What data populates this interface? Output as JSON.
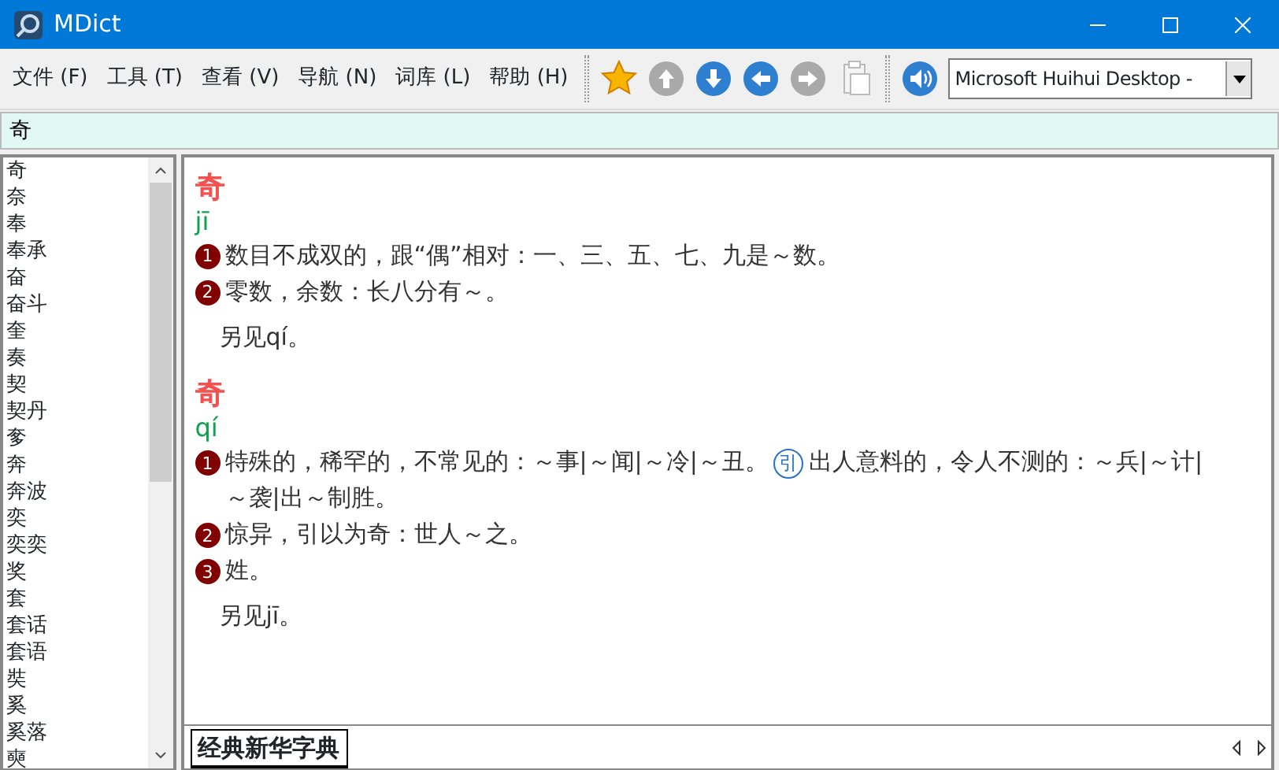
{
  "window": {
    "title": "MDict"
  },
  "menu": [
    "文件 (F)",
    "工具 (T)",
    "查看 (V)",
    "导航 (N)",
    "词库 (L)",
    "帮助 (H)"
  ],
  "toolbar": [
    {
      "kind": "star",
      "disabled": false
    },
    {
      "kind": "up",
      "disabled": true
    },
    {
      "kind": "down",
      "disabled": false
    },
    {
      "kind": "back",
      "disabled": false
    },
    {
      "kind": "forward",
      "disabled": true
    },
    {
      "kind": "clipboard",
      "disabled": true
    },
    {
      "kind": "speaker",
      "disabled": false
    }
  ],
  "voice": {
    "value": "Microsoft Huihui Desktop -"
  },
  "search": {
    "value": "奇"
  },
  "word_list": [
    "奇",
    "奈",
    "奉",
    "奉承",
    "奋",
    "奋斗",
    "奎",
    "奏",
    "契",
    "契丹",
    "奓",
    "奔",
    "奔波",
    "奕",
    "奕奕",
    "奖",
    "套",
    "套话",
    "套语",
    "奘",
    "奚",
    "奚落",
    "奭"
  ],
  "entries": [
    {
      "headword": "奇",
      "pinyin": "jī",
      "senses": [
        {
          "number": "1",
          "segments": [
            {
              "kind": "text",
              "text": "数目不成双的，跟“偶”相对：一、三、五、七、九是～数。"
            }
          ]
        },
        {
          "number": "2",
          "segments": [
            {
              "kind": "text",
              "text": "零数，余数：长八分有～。"
            }
          ]
        }
      ],
      "see_also": "另见qí。"
    },
    {
      "headword": "奇",
      "pinyin": "qí",
      "senses": [
        {
          "number": "1",
          "segments": [
            {
              "kind": "text",
              "text": "特殊的，稀罕的，不常见的：～事|～闻|～冷|～丑。"
            },
            {
              "kind": "tag",
              "text": "引"
            },
            {
              "kind": "text",
              "text": "出人意料的，令人不测的：～兵|～计|"
            },
            {
              "kind": "text",
              "text": "～袭|出～制胜。"
            }
          ]
        },
        {
          "number": "2",
          "segments": [
            {
              "kind": "text",
              "text": "惊异，引以为奇：世人～之。"
            }
          ]
        },
        {
          "number": "3",
          "segments": [
            {
              "kind": "text",
              "text": "姓。"
            }
          ]
        }
      ],
      "see_also": "另见jī。"
    }
  ],
  "dictionary_tabs": [
    {
      "label": "经典新华字典",
      "selected": true
    }
  ]
}
